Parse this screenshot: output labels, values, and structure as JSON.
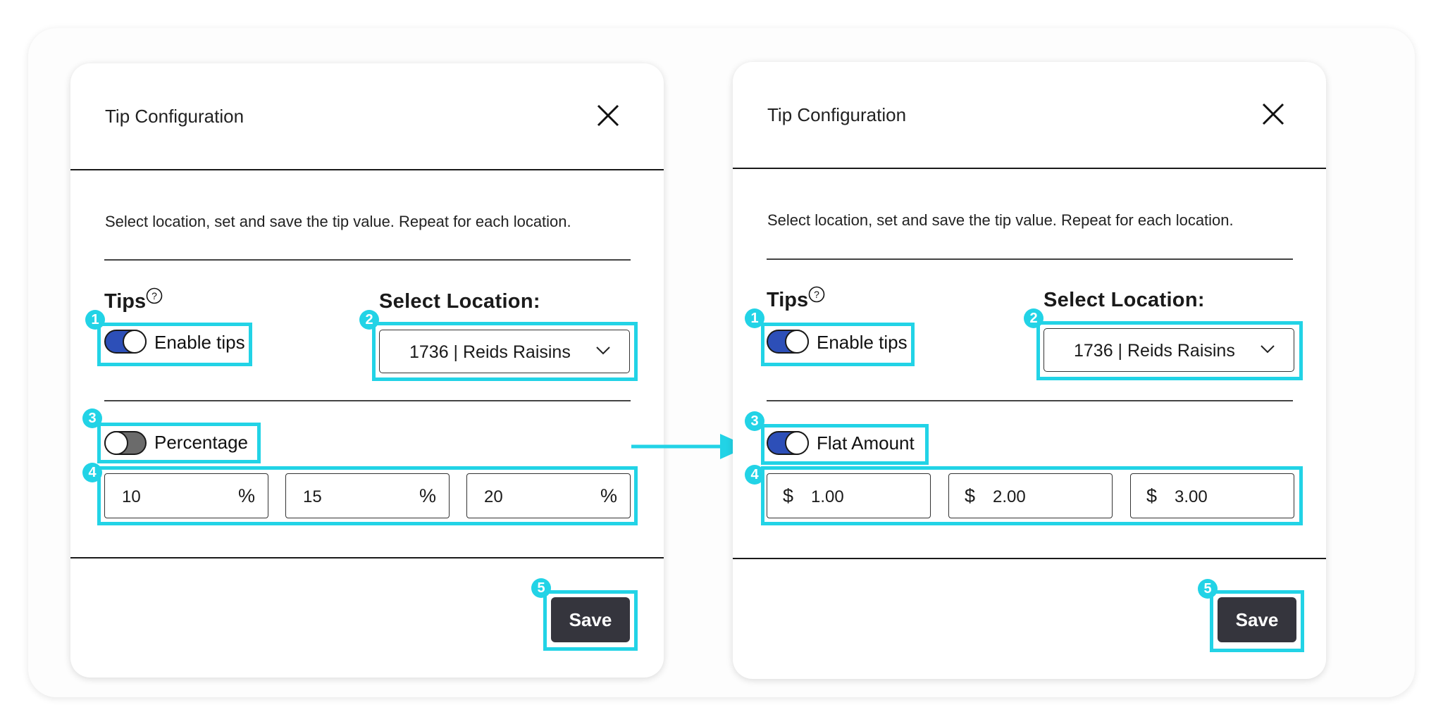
{
  "panels": {
    "left": {
      "title": "Tip Configuration",
      "description": "Select location, set and save the tip value. Repeat for each location.",
      "tips_label": "Tips",
      "enable_tips_label": "Enable tips",
      "enable_tips_on": true,
      "location_label": "Select Location:",
      "location_value": "1736 | Reids Raisins",
      "mode_label": "Percentage",
      "mode_on": false,
      "tip_values": [
        "10",
        "15",
        "20"
      ],
      "tip_unit": "%",
      "save_label": "Save"
    },
    "right": {
      "title": "Tip Configuration",
      "description": "Select location, set and save the tip value. Repeat for each location.",
      "tips_label": "Tips",
      "enable_tips_label": "Enable tips",
      "enable_tips_on": true,
      "location_label": "Select Location:",
      "location_value": "1736 | Reids Raisins",
      "mode_label": "Flat Amount",
      "mode_on": true,
      "tip_values": [
        "1.00",
        "2.00",
        "3.00"
      ],
      "tip_unit": "$",
      "save_label": "Save"
    }
  },
  "annotations": {
    "badges": [
      "1",
      "2",
      "3",
      "4",
      "5"
    ],
    "highlight_color": "#22d3e6"
  },
  "icons": {
    "close": "close-icon",
    "help": "help-circle-icon",
    "chevron": "chevron-down-icon",
    "arrow": "arrow-right-icon"
  },
  "colors": {
    "toggle_on": "#2d4fb8",
    "toggle_off": "#6b6b6b",
    "save_button": "#35353d"
  }
}
